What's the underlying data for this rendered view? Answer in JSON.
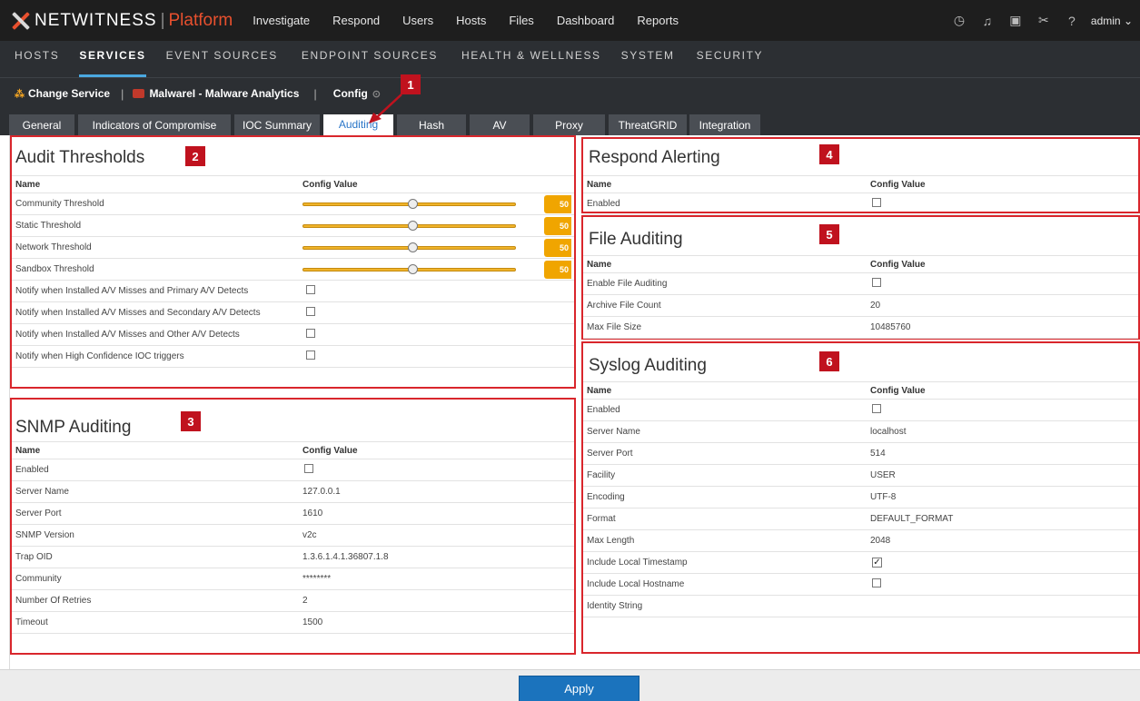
{
  "brand": {
    "name": "NETWITNESS",
    "sep": "|",
    "product": "Platform"
  },
  "top_nav": [
    "Investigate",
    "Respond",
    "Users",
    "Hosts",
    "Files",
    "Dashboard",
    "Reports"
  ],
  "top_icons": [
    "timer-icon",
    "bell-icon",
    "clipboard-icon",
    "tools-icon",
    "help-icon"
  ],
  "user": {
    "label": "admin ⌄"
  },
  "sub_nav": [
    "HOSTS",
    "SERVICES",
    "EVENT SOURCES",
    "ENDPOINT SOURCES",
    "HEALTH & WELLNESS",
    "SYSTEM",
    "SECURITY"
  ],
  "service_bar": {
    "change_service": "Change Service",
    "pipe": "|",
    "service_name": "MalwareI - Malware Analytics",
    "config": "Config"
  },
  "tabs": [
    "General",
    "Indicators of Compromise",
    "IOC Summary",
    "Auditing",
    "Hash",
    "AV",
    "Proxy",
    "ThreatGRID",
    "Integration"
  ],
  "active_tab": "Auditing",
  "callouts": [
    "1",
    "2",
    "3",
    "4",
    "5",
    "6"
  ],
  "audit_thresholds": {
    "title": "Audit Thresholds",
    "col_name": "Name",
    "col_value": "Config Value",
    "sliders": [
      {
        "name": "Community Threshold",
        "value": "50"
      },
      {
        "name": "Static Threshold",
        "value": "50"
      },
      {
        "name": "Network Threshold",
        "value": "50"
      },
      {
        "name": "Sandbox Threshold",
        "value": "50"
      }
    ],
    "checks": [
      "Notify when Installed A/V Misses and Primary A/V Detects",
      "Notify when Installed A/V Misses and Secondary A/V Detects",
      "Notify when Installed A/V Misses and Other A/V Detects",
      "Notify when High Confidence IOC triggers"
    ]
  },
  "snmp": {
    "title": "SNMP Auditing",
    "col_name": "Name",
    "col_value": "Config Value",
    "rows": [
      {
        "name": "Enabled",
        "value": ""
      },
      {
        "name": "Server Name",
        "value": "127.0.0.1"
      },
      {
        "name": "Server Port",
        "value": "1610"
      },
      {
        "name": "SNMP Version",
        "value": "v2c"
      },
      {
        "name": "Trap OID",
        "value": "1.3.6.1.4.1.36807.1.8"
      },
      {
        "name": "Community",
        "value": "********"
      },
      {
        "name": "Number Of Retries",
        "value": "2"
      },
      {
        "name": "Timeout",
        "value": "1500"
      }
    ]
  },
  "respond": {
    "title": "Respond Alerting",
    "col_name": "Name",
    "col_value": "Config Value",
    "rows": [
      {
        "name": "Enabled",
        "value": ""
      }
    ]
  },
  "file_auditing": {
    "title": "File Auditing",
    "col_name": "Name",
    "col_value": "Config Value",
    "rows": [
      {
        "name": "Enable File Auditing",
        "value": ""
      },
      {
        "name": "Archive File Count",
        "value": "20"
      },
      {
        "name": "Max File Size",
        "value": "10485760"
      }
    ]
  },
  "syslog": {
    "title": "Syslog Auditing",
    "col_name": "Name",
    "col_value": "Config Value",
    "rows": [
      {
        "name": "Enabled",
        "value": ""
      },
      {
        "name": "Server Name",
        "value": "localhost"
      },
      {
        "name": "Server Port",
        "value": "514"
      },
      {
        "name": "Facility",
        "value": "USER"
      },
      {
        "name": "Encoding",
        "value": "UTF-8"
      },
      {
        "name": "Format",
        "value": "DEFAULT_FORMAT"
      },
      {
        "name": "Max Length",
        "value": "2048"
      },
      {
        "name": "Include Local Timestamp",
        "value": "✓"
      },
      {
        "name": "Include Local Hostname",
        "value": ""
      },
      {
        "name": "Identity String",
        "value": ""
      }
    ]
  },
  "apply_label": "Apply",
  "colors": {
    "callout_red": "#c0121e",
    "panel_border": "#d9262c",
    "accent_blue": "#1b73bd",
    "brand_orange": "#e8502e",
    "slider_gold": "#f0a500"
  }
}
